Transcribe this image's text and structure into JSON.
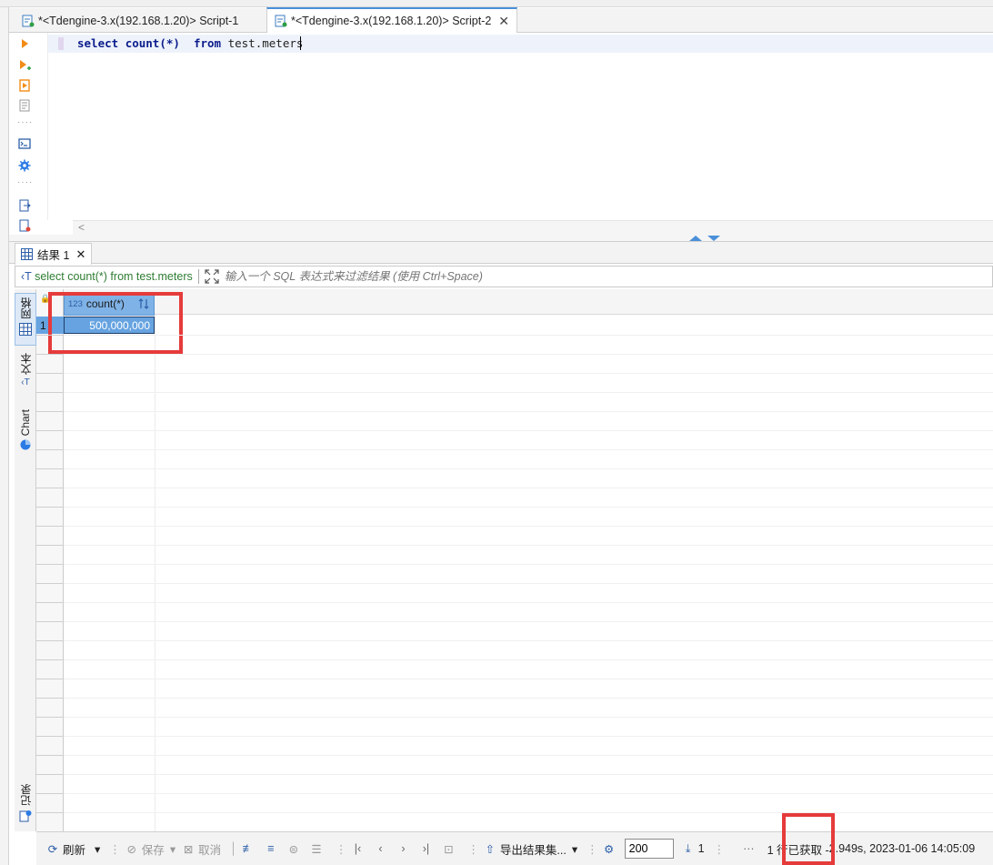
{
  "tabs": [
    {
      "label": "*<Tdengine-3.x(192.168.1.20)> Script-1",
      "active": false
    },
    {
      "label": "*<Tdengine-3.x(192.168.1.20)> Script-2",
      "active": true
    }
  ],
  "tab_close_glyph": "✕",
  "editor": {
    "sql_keyword_select": "select",
    "sql_function": "count(*)",
    "sql_keyword_from": "from",
    "sql_table": "test.meters",
    "scroll_left_glyph": "<"
  },
  "results": {
    "tab_label": "结果 1",
    "tab_close_glyph": "✕",
    "filter_query": "select count(*) from test.meters",
    "filter_placeholder": "输入一个 SQL 表达式来过滤结果 (使用 Ctrl+Space)"
  },
  "side_tabs": {
    "grid": "网格",
    "text": "文本",
    "chart": "Chart",
    "record": "记录"
  },
  "grid": {
    "column_type": "123",
    "column_name": "count(*)",
    "row_number": "1",
    "cell_value": "500,000,000"
  },
  "status_bar": {
    "refresh": "刷新",
    "save": "保存",
    "cancel": "取消",
    "export": "导出结果集...",
    "fetch_size": "200",
    "page_count": "1",
    "ellipsis": "···",
    "fetch_info": "1 行已获取 - ",
    "duration": "2.949s",
    "timestamp": ", 2023-01-06 14:05:09"
  },
  "colors": {
    "accent": "#4a90d9",
    "selected_cell": "#66a3e0",
    "highlight": "#e63b3b",
    "sql_keyword": "#0b1c8c",
    "filter_text": "#2e7d32"
  }
}
